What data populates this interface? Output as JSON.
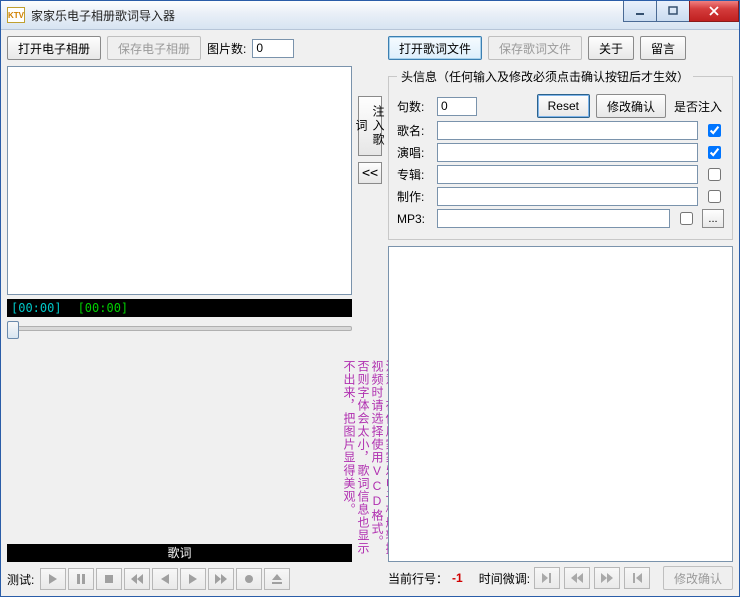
{
  "window": {
    "title": "家家乐电子相册歌词导入器"
  },
  "left": {
    "open_album": "打开电子相册",
    "save_album": "保存电子相册",
    "pic_count_label": "图片数:",
    "pic_count_value": "0",
    "time_a": "[00:00]",
    "time_b": "[00:00]",
    "lyric_label": "歌词",
    "test_label": "测试:"
  },
  "mid": {
    "inject_label": "注入歌词",
    "back_label": "<<",
    "note": "注意：在使用家家乐电子相册转换视频时请选择使用VCD格式。否则字体会太小，歌词信息也显示不出来，把图片显得美观。"
  },
  "right": {
    "open_lyric": "打开歌词文件",
    "save_lyric": "保存歌词文件",
    "about": "关于",
    "message": "留言",
    "head_legend": "头信息（任何输入及修改必须点击确认按钮后才生效）",
    "sentence_label": "句数:",
    "sentence_value": "0",
    "reset": "Reset",
    "confirm": "修改确认",
    "inject_header": "是否注入",
    "fields": {
      "song": "歌名:",
      "singer": "演唱:",
      "album": "专辑:",
      "maker": "制作:",
      "mp3": "MP3:"
    },
    "cur_line_label": "当前行号：",
    "cur_line_value": "-1",
    "time_adj_label": "时间微调:",
    "confirm2": "修改确认"
  }
}
